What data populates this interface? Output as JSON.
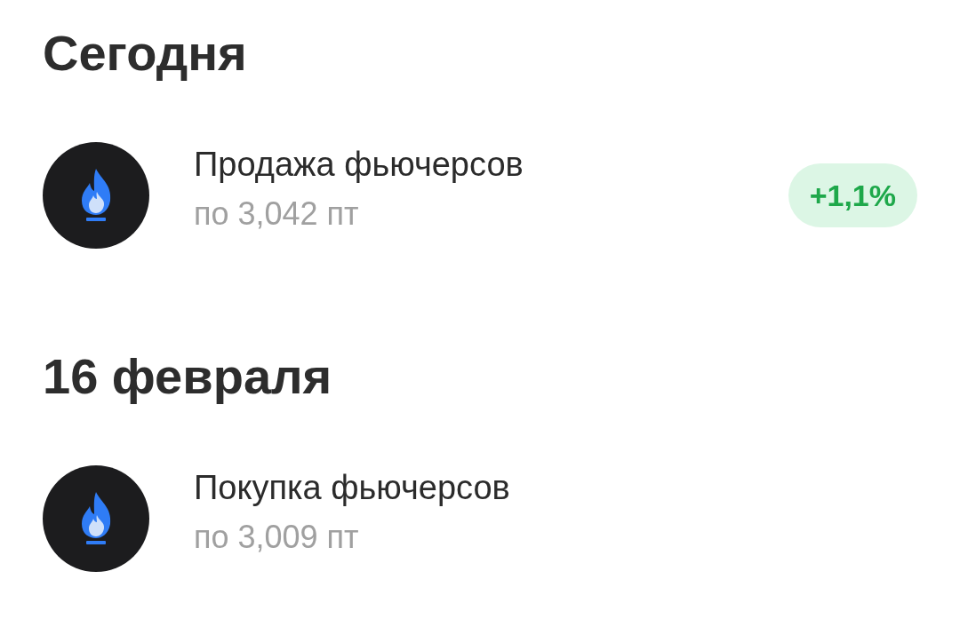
{
  "sections": [
    {
      "title": "Сегодня",
      "operations": [
        {
          "title": "Продажа фьючерсов",
          "price": "по 3,042 пт",
          "change": "+1,1%"
        }
      ]
    },
    {
      "title": "16 февраля",
      "operations": [
        {
          "title": "Покупка фьючерсов",
          "price": "по 3,009 пт"
        }
      ]
    }
  ]
}
